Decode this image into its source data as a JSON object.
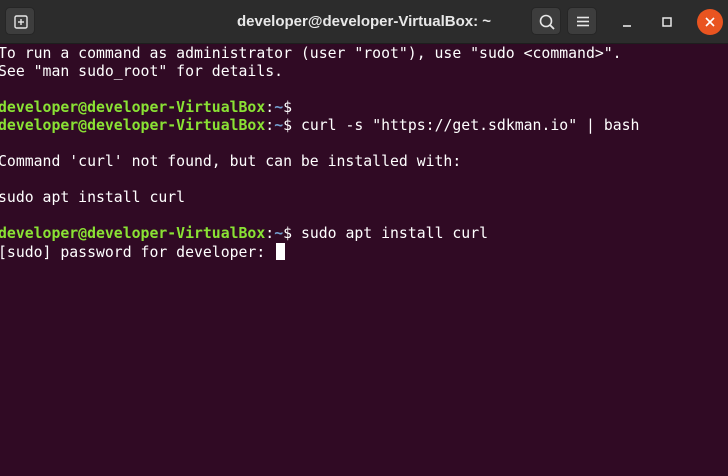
{
  "window": {
    "title": "developer@developer-VirtualBox: ~"
  },
  "titlebar": {
    "new_tab_icon": "new-tab-icon",
    "search_icon": "search-icon",
    "menu_icon": "hamburger-menu-icon",
    "minimize_icon": "minimize-icon",
    "maximize_icon": "maximize-icon",
    "close_icon": "close-icon"
  },
  "colors": {
    "terminal_bg": "#300a24",
    "prompt_user": "#8ae234",
    "prompt_path": "#729fcf",
    "close_button": "#e95420"
  },
  "terminal": {
    "lines": {
      "l1": "To run a command as administrator (user \"root\"), use \"sudo <command>\".",
      "l2": "See \"man sudo_root\" for details.",
      "prompt1_user": "developer@developer-VirtualBox",
      "prompt1_path": "~",
      "prompt2_user": "developer@developer-VirtualBox",
      "prompt2_path": "~",
      "prompt2_cmd": " curl -s \"https://get.sdkman.io\" | bash",
      "l5": "Command 'curl' not found, but can be installed with:",
      "l6": "sudo apt install curl",
      "prompt3_user": "developer@developer-VirtualBox",
      "prompt3_path": "~",
      "prompt3_cmd": " sudo apt install curl",
      "l8": "[sudo] password for developer: "
    },
    "sep": ":",
    "dollar": "$"
  }
}
